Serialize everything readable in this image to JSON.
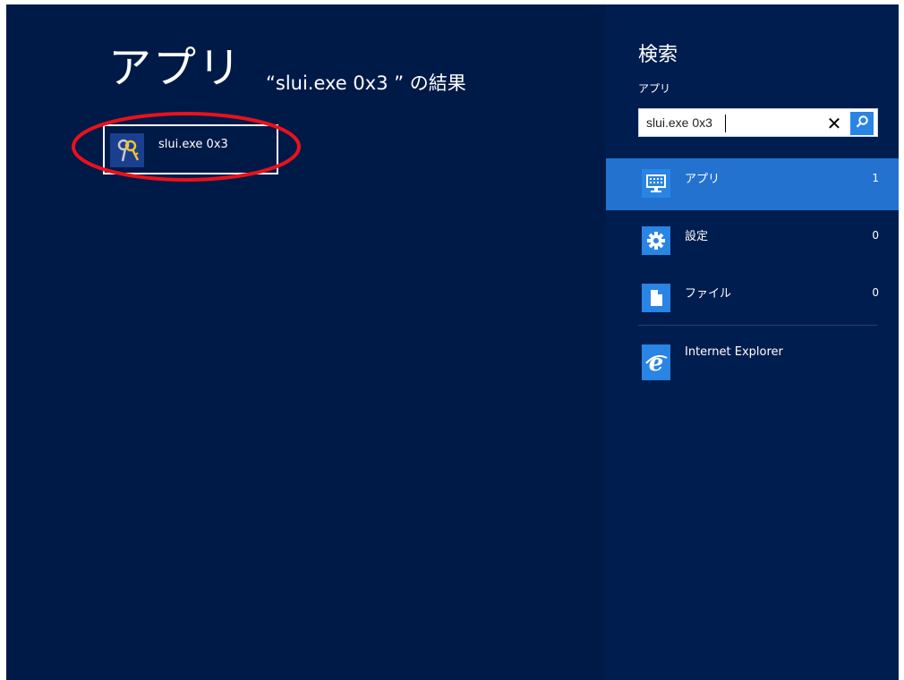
{
  "results": {
    "title": "アプリ",
    "subtitle": "“slui.exe 0x3 ” の結果",
    "items": [
      {
        "label": "slui.exe 0x3",
        "icon": "keys-icon"
      }
    ]
  },
  "charm": {
    "title": "検索",
    "scope": "アプリ",
    "search": {
      "value": "slui.exe 0x3"
    },
    "categories": [
      {
        "label": "アプリ",
        "count": "1",
        "icon": "keyboard-icon",
        "selected": true
      },
      {
        "label": "設定",
        "count": "0",
        "icon": "gear-icon",
        "selected": false
      },
      {
        "label": "ファイル",
        "count": "0",
        "icon": "file-icon",
        "selected": false
      }
    ],
    "apps": [
      {
        "label": "Internet Explorer",
        "icon": "internet-explorer-icon"
      }
    ]
  },
  "colors": {
    "background": "#001a47",
    "charm_background": "#001d4f",
    "accent": "#2a84e4",
    "selected": "#2372d0",
    "annotation": "#e8121c"
  }
}
